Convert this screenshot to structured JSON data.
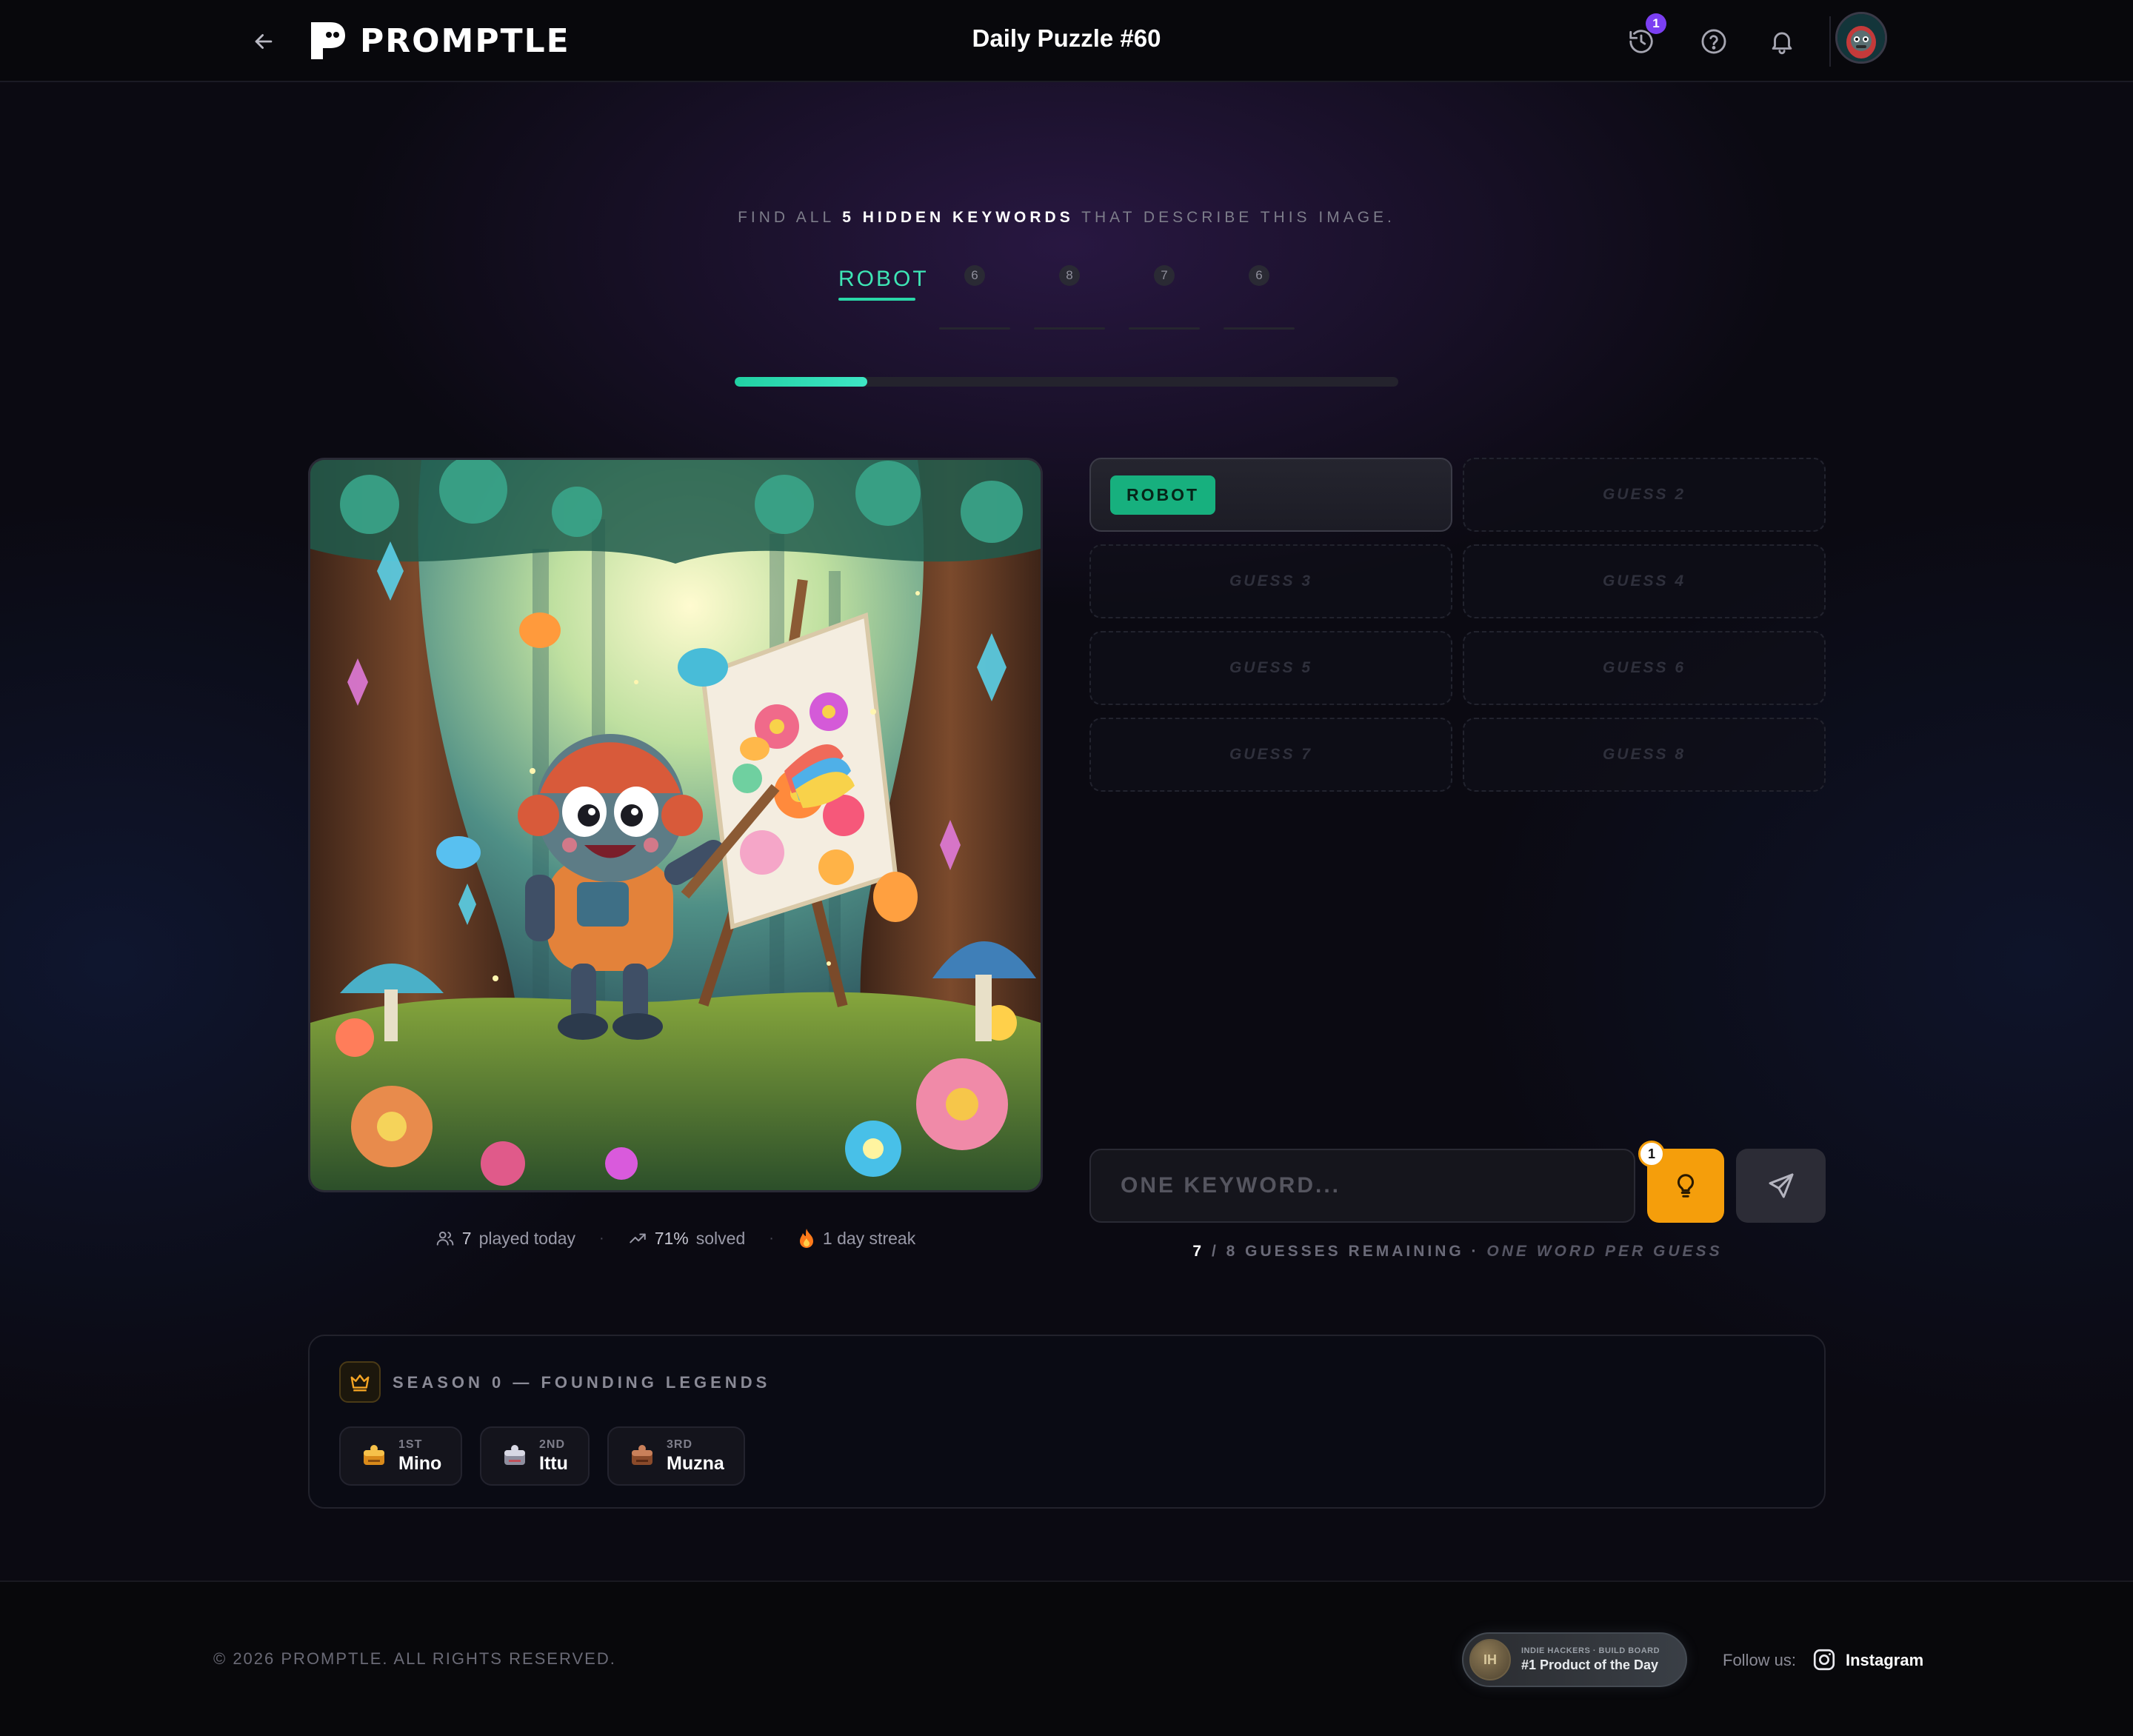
{
  "header": {
    "app_name": "PROMPTLE",
    "title": "Daily Puzzle #60",
    "history_badge": "1",
    "icons": [
      "back-arrow-icon",
      "history-icon",
      "help-icon",
      "bell-icon",
      "avatar"
    ]
  },
  "instruction": {
    "prefix": "FIND ALL ",
    "highlight": "5 HIDDEN KEYWORDS",
    "suffix": " THAT DESCRIBE THIS IMAGE."
  },
  "keywords": {
    "found": [
      "ROBOT"
    ],
    "hidden_lengths": [
      "6",
      "8",
      "7",
      "6"
    ]
  },
  "progress": {
    "fraction": 0.2
  },
  "stats": {
    "played_value": "7",
    "played_label": "played today",
    "solved_value": "71%",
    "solved_label": "solved",
    "streak_label": "1 day streak"
  },
  "guesses": [
    {
      "label": "ROBOT",
      "filled": true
    },
    {
      "label": "GUESS 2",
      "filled": false
    },
    {
      "label": "GUESS 3",
      "filled": false
    },
    {
      "label": "GUESS 4",
      "filled": false
    },
    {
      "label": "GUESS 5",
      "filled": false
    },
    {
      "label": "GUESS 6",
      "filled": false
    },
    {
      "label": "GUESS 7",
      "filled": false
    },
    {
      "label": "GUESS 8",
      "filled": false
    }
  ],
  "input": {
    "placeholder": "ONE KEYWORD...",
    "value": ""
  },
  "hint": {
    "badge": "1"
  },
  "remaining": {
    "count": "7",
    "total": "8",
    "label": "GUESSES REMAINING",
    "rule": "ONE WORD PER GUESS"
  },
  "season": {
    "title": "SEASON 0 — FOUNDING LEGENDS",
    "legends": [
      {
        "rank": "1ST",
        "name": "Mino"
      },
      {
        "rank": "2ND",
        "name": "Ittu"
      },
      {
        "rank": "3RD",
        "name": "Muzna"
      }
    ]
  },
  "footer": {
    "copyright": "© 2026 PROMPTLE. ALL RIGHTS RESERVED.",
    "badge_top": "INDIE HACKERS · BUILD BOARD",
    "badge_bottom": "#1 Product of the Day",
    "follow_label": "Follow us:",
    "instagram": "Instagram"
  },
  "colors": {
    "accent_green": "#2ad7a8",
    "hint_orange": "#f59e0b",
    "badge_purple": "#7b3ff2",
    "chip_green": "#17b07e"
  }
}
